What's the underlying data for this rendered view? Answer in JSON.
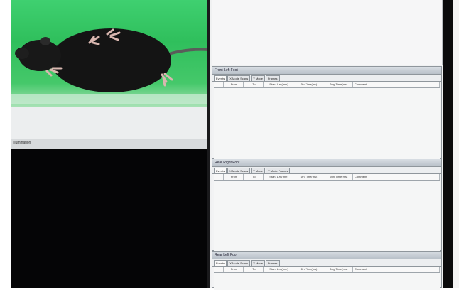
{
  "video": {
    "status_label": "Illumination"
  },
  "panels": [
    {
      "title": "Front Left Foot",
      "tabs": [],
      "columns": [
        "",
        "From",
        "To",
        "Stan. Len(mm)",
        "Stn Time(ms)",
        "Swg Time(ms)",
        "Comment",
        ""
      ]
    },
    {
      "title": "Rear Right Foot",
      "tabs": [
        "Events",
        "X Mode Scans",
        "Y Mode",
        "Y Mode Frames"
      ],
      "columns": [
        "",
        "From",
        "To",
        "Stan. Len(mm)",
        "Stn Time(ms)",
        "Swg Time(ms)",
        "Comment",
        ""
      ]
    },
    {
      "title": "Rear Left Foot",
      "tabs": [
        "Events",
        "X Mode Scans",
        "Y Mode",
        "Frames"
      ],
      "columns": [
        "",
        "From",
        "To",
        "Stan. Len(mm)",
        "Stn Time(ms)",
        "Swg Time(ms)",
        "Comment",
        ""
      ]
    }
  ],
  "panel1_tabs": [
    "Events",
    "X Mode Scans",
    "Y Mode",
    "Frames"
  ]
}
